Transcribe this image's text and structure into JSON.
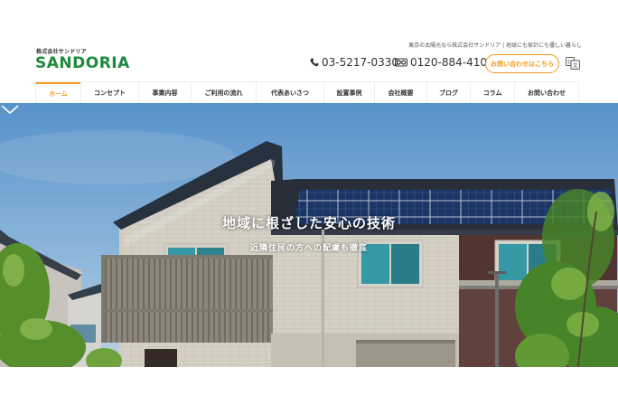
{
  "header": {
    "logo_sub": "株式会社サンドリア",
    "logo_word": "SANDORIA",
    "tagline": "東京の太陽光なら株式会社サンドリア | 地球にも家計にも優しい暮らし",
    "phone1": "03-5217-0330",
    "phone2": "0120-884-410",
    "contact_label": "お問い合わせはこちら",
    "icons": {
      "phone": "phone-icon",
      "freedial": "free-dial-icon",
      "translate": "translate-icon"
    }
  },
  "nav": {
    "items": [
      {
        "label": "ホーム",
        "active": true
      },
      {
        "label": "コンセプト"
      },
      {
        "label": "事業内容"
      },
      {
        "label": "ご利用の流れ"
      },
      {
        "label": "代表あいさつ"
      },
      {
        "label": "設置事例"
      },
      {
        "label": "会社概要"
      },
      {
        "label": "ブログ"
      },
      {
        "label": "コラム"
      },
      {
        "label": "お問い合わせ"
      }
    ]
  },
  "hero": {
    "title": "地域に根ざした安心の技術",
    "subtitle": "近隣住民の方への配慮も徹底",
    "scroll_icon": "chevron-down-icon"
  },
  "colors": {
    "accent": "#f39a1e",
    "brand_green": "#1d8a3c",
    "sky": "#7fb6e6"
  }
}
